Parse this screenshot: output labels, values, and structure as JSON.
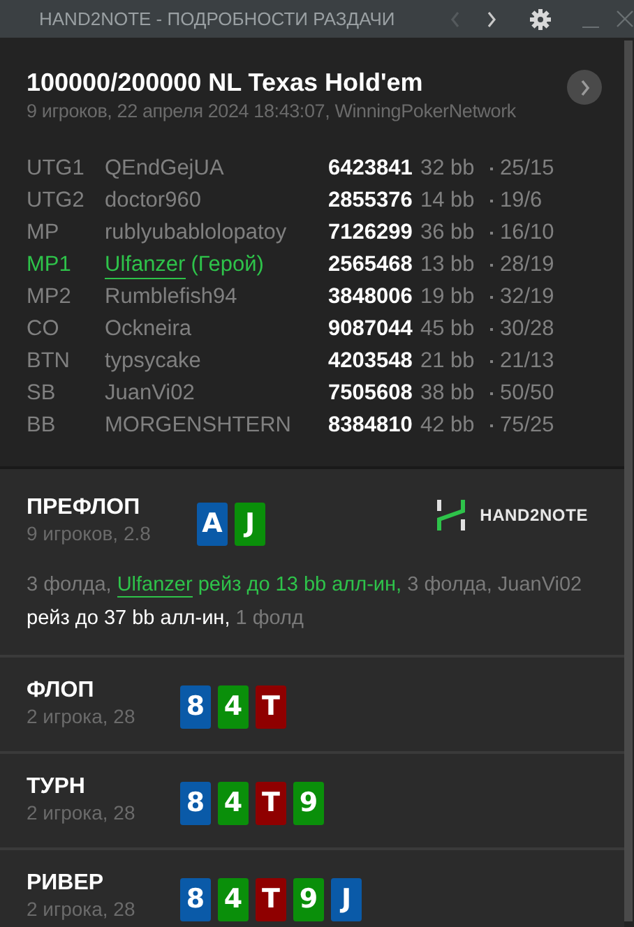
{
  "window": {
    "title": "HAND2NOTE - ПОДРОБНОСТИ РАЗДАЧИ",
    "prev_disabled": true,
    "next_disabled": false
  },
  "hand": {
    "title": "100000/200000 NL Texas Hold'em",
    "subtitle": "9 игроков, 22 апреля 2024 18:43:07, WinningPokerNetwork"
  },
  "players": [
    {
      "position": "UTG1",
      "name": "QEndGejUA",
      "id": "6423841",
      "stack": "32 bb",
      "stats": "25/15",
      "hero": false
    },
    {
      "position": "UTG2",
      "name": "doctor960",
      "id": "2855376",
      "stack": "14 bb",
      "stats": "19/6",
      "hero": false
    },
    {
      "position": "MP",
      "name": "rublyubablolopatoy",
      "id": "7126299",
      "stack": "36 bb",
      "stats": "16/10",
      "hero": false
    },
    {
      "position": "MP1",
      "name": "Ulfanzer",
      "hero_tag": "(Герой)",
      "id": "2565468",
      "stack": "13 bb",
      "stats": "28/19",
      "hero": true
    },
    {
      "position": "MP2",
      "name": "Rumblefish94",
      "id": "3848006",
      "stack": "19 bb",
      "stats": "32/19",
      "hero": false
    },
    {
      "position": "CO",
      "name": "Ockneira",
      "id": "9087044",
      "stack": "45 bb",
      "stats": "30/28",
      "hero": false
    },
    {
      "position": "BTN",
      "name": "typsycake",
      "id": "4203548",
      "stack": "21 bb",
      "stats": "21/13",
      "hero": false
    },
    {
      "position": "SB",
      "name": "JuanVi02",
      "id": "7505608",
      "stack": "38 bb",
      "stats": "50/50",
      "hero": false
    },
    {
      "position": "BB",
      "name": "MORGENSHTERN",
      "id": "8384810",
      "stack": "42 bb",
      "stats": "75/25",
      "hero": false
    }
  ],
  "streets": [
    {
      "name": "ПРЕФЛОП",
      "info": "9 игроков, 2.8",
      "cards": [
        {
          "rank": "A",
          "color": "#0a5aa8"
        },
        {
          "rank": "J",
          "color": "#0a8f0a"
        }
      ],
      "logo": "HAND2NOTE",
      "actions": [
        {
          "kind": "muted",
          "text": "3 фолда, "
        },
        {
          "kind": "hero_link",
          "text": "Ulfanzer"
        },
        {
          "kind": "hero",
          "text": " рейз до 13 bb алл-ин,"
        },
        {
          "kind": "muted",
          "text": " 3 фолда, "
        },
        {
          "kind": "link",
          "text": "JuanVi02"
        },
        {
          "kind": "plain",
          "text": " рейз до 37 bb алл-ин,"
        },
        {
          "kind": "muted",
          "text": " 1 фолд"
        }
      ]
    },
    {
      "name": "ФЛОП",
      "info": "2 игрока, 28",
      "cards": [
        {
          "rank": "8",
          "color": "#0a5aa8"
        },
        {
          "rank": "4",
          "color": "#0a8f0a"
        },
        {
          "rank": "T",
          "color": "#8f0000"
        }
      ]
    },
    {
      "name": "ТУРН",
      "info": "2 игрока, 28",
      "cards": [
        {
          "rank": "8",
          "color": "#0a5aa8"
        },
        {
          "rank": "4",
          "color": "#0a8f0a"
        },
        {
          "rank": "T",
          "color": "#8f0000"
        },
        {
          "rank": "9",
          "color": "#0a8f0a"
        }
      ]
    },
    {
      "name": "РИВЕР",
      "info": "2 игрока, 28",
      "cards": [
        {
          "rank": "8",
          "color": "#0a5aa8"
        },
        {
          "rank": "4",
          "color": "#0a8f0a"
        },
        {
          "rank": "T",
          "color": "#8f0000"
        },
        {
          "rank": "9",
          "color": "#0a8f0a"
        },
        {
          "rank": "J",
          "color": "#0a5aa8"
        }
      ]
    }
  ]
}
